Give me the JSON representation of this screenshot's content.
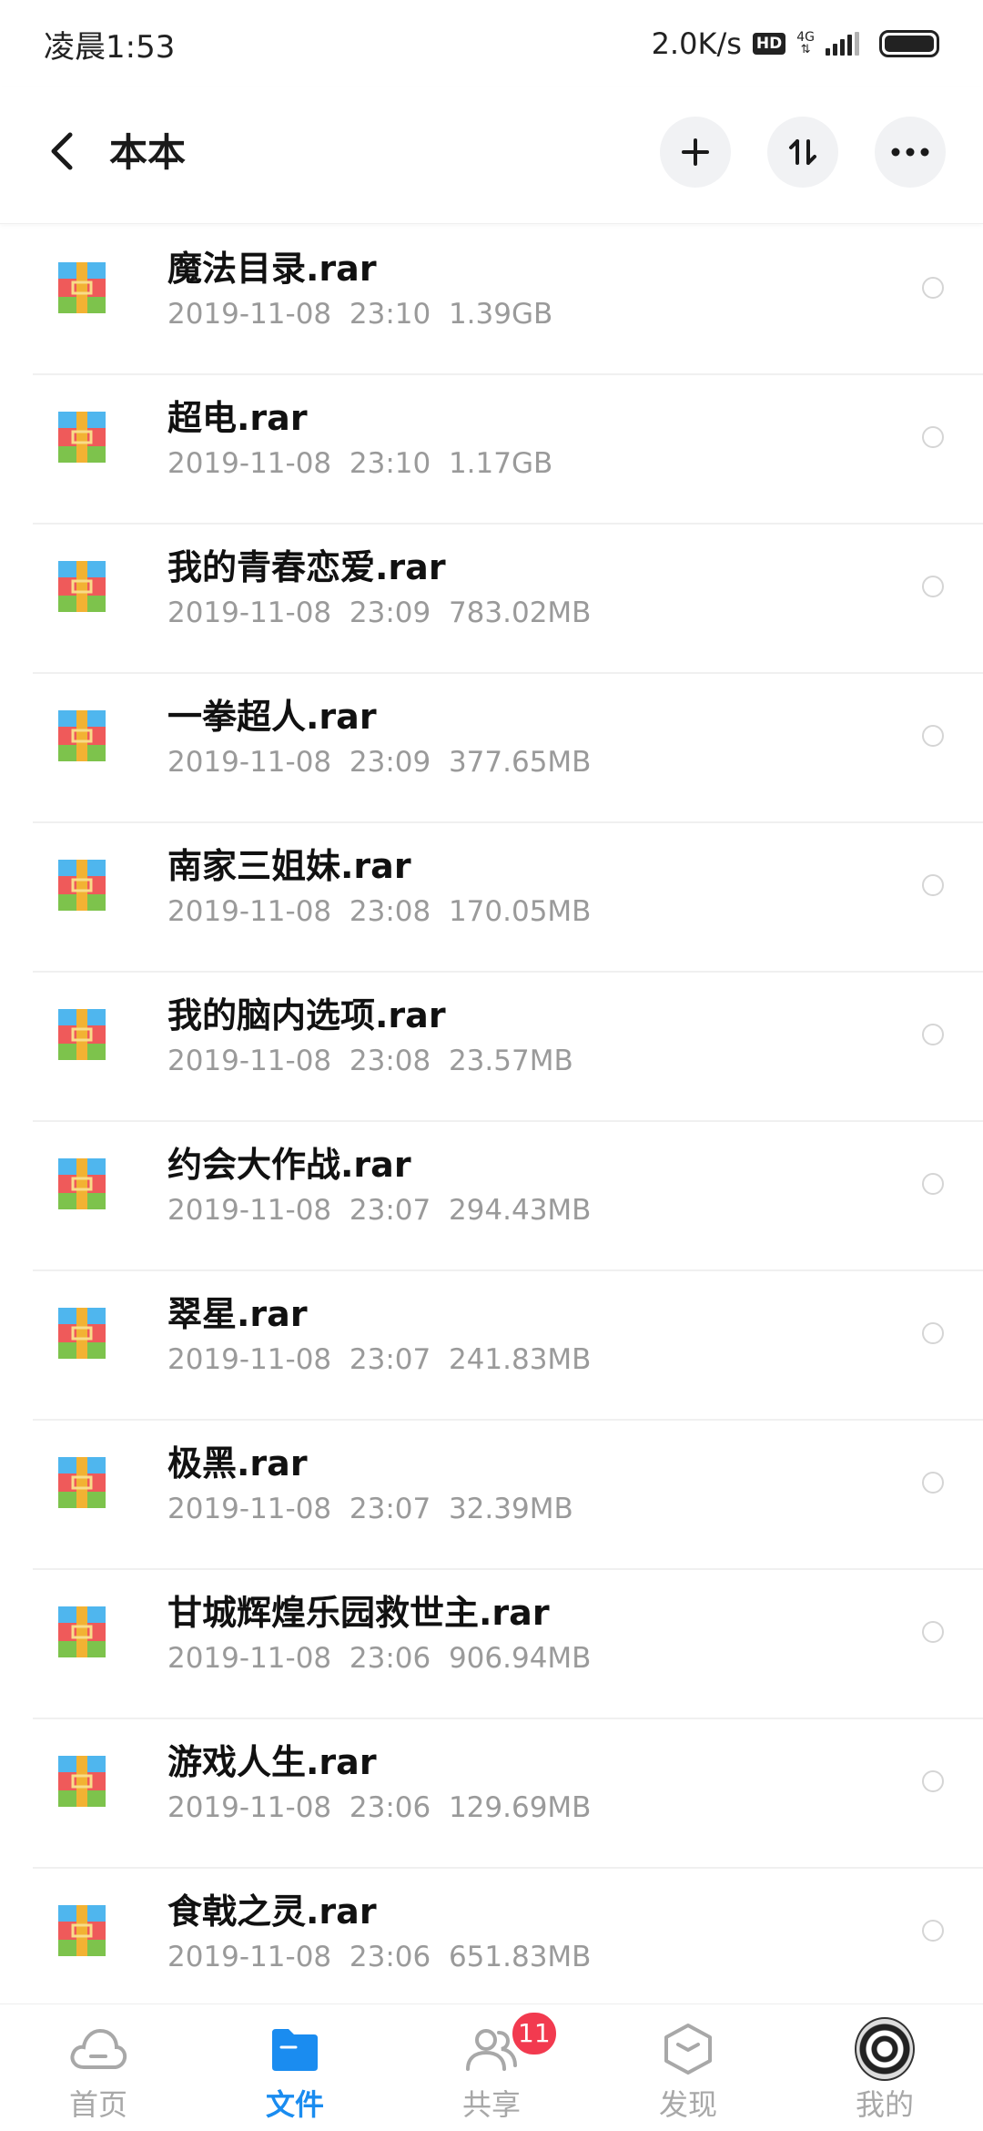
{
  "status_bar": {
    "time": "凌晨1:53",
    "speed": "2.0K/s",
    "hd": "HD",
    "network": "4G",
    "network_arrows": "⇅"
  },
  "header": {
    "title": "本本",
    "back_icon": "chevron-left-icon",
    "actions": [
      "plus-icon",
      "sort-icon",
      "more-icon"
    ]
  },
  "files": [
    {
      "name": "魔法目录.rar",
      "date": "2019-11-08",
      "time": "23:10",
      "size": "1.39GB"
    },
    {
      "name": "超电.rar",
      "date": "2019-11-08",
      "time": "23:10",
      "size": "1.17GB"
    },
    {
      "name": "我的青春恋爱.rar",
      "date": "2019-11-08",
      "time": "23:09",
      "size": "783.02MB"
    },
    {
      "name": "一拳超人.rar",
      "date": "2019-11-08",
      "time": "23:09",
      "size": "377.65MB"
    },
    {
      "name": "南家三姐妹.rar",
      "date": "2019-11-08",
      "time": "23:08",
      "size": "170.05MB"
    },
    {
      "name": "我的脑内选项.rar",
      "date": "2019-11-08",
      "time": "23:08",
      "size": "23.57MB"
    },
    {
      "name": "约会大作战.rar",
      "date": "2019-11-08",
      "time": "23:07",
      "size": "294.43MB"
    },
    {
      "name": "翠星.rar",
      "date": "2019-11-08",
      "time": "23:07",
      "size": "241.83MB"
    },
    {
      "name": "极黑.rar",
      "date": "2019-11-08",
      "time": "23:07",
      "size": "32.39MB"
    },
    {
      "name": "甘城辉煌乐园救世主.rar",
      "date": "2019-11-08",
      "time": "23:06",
      "size": "906.94MB"
    },
    {
      "name": "游戏人生.rar",
      "date": "2019-11-08",
      "time": "23:06",
      "size": "129.69MB"
    },
    {
      "name": "食戟之灵.rar",
      "date": "2019-11-08",
      "time": "23:06",
      "size": "651.83MB"
    }
  ],
  "bottom_nav": [
    {
      "label": "首页",
      "icon": "cloud-icon",
      "active": false
    },
    {
      "label": "文件",
      "icon": "folder-icon",
      "active": true
    },
    {
      "label": "共享",
      "icon": "people-icon",
      "active": false,
      "badge": "11"
    },
    {
      "label": "发现",
      "icon": "cube-icon",
      "active": false
    },
    {
      "label": "我的",
      "icon": "avatar",
      "active": false
    }
  ],
  "colors": {
    "accent": "#1a8cf0",
    "badge": "#f23a4f",
    "meta_text": "#9a9a9a",
    "inactive_nav": "#a8a8a8"
  }
}
